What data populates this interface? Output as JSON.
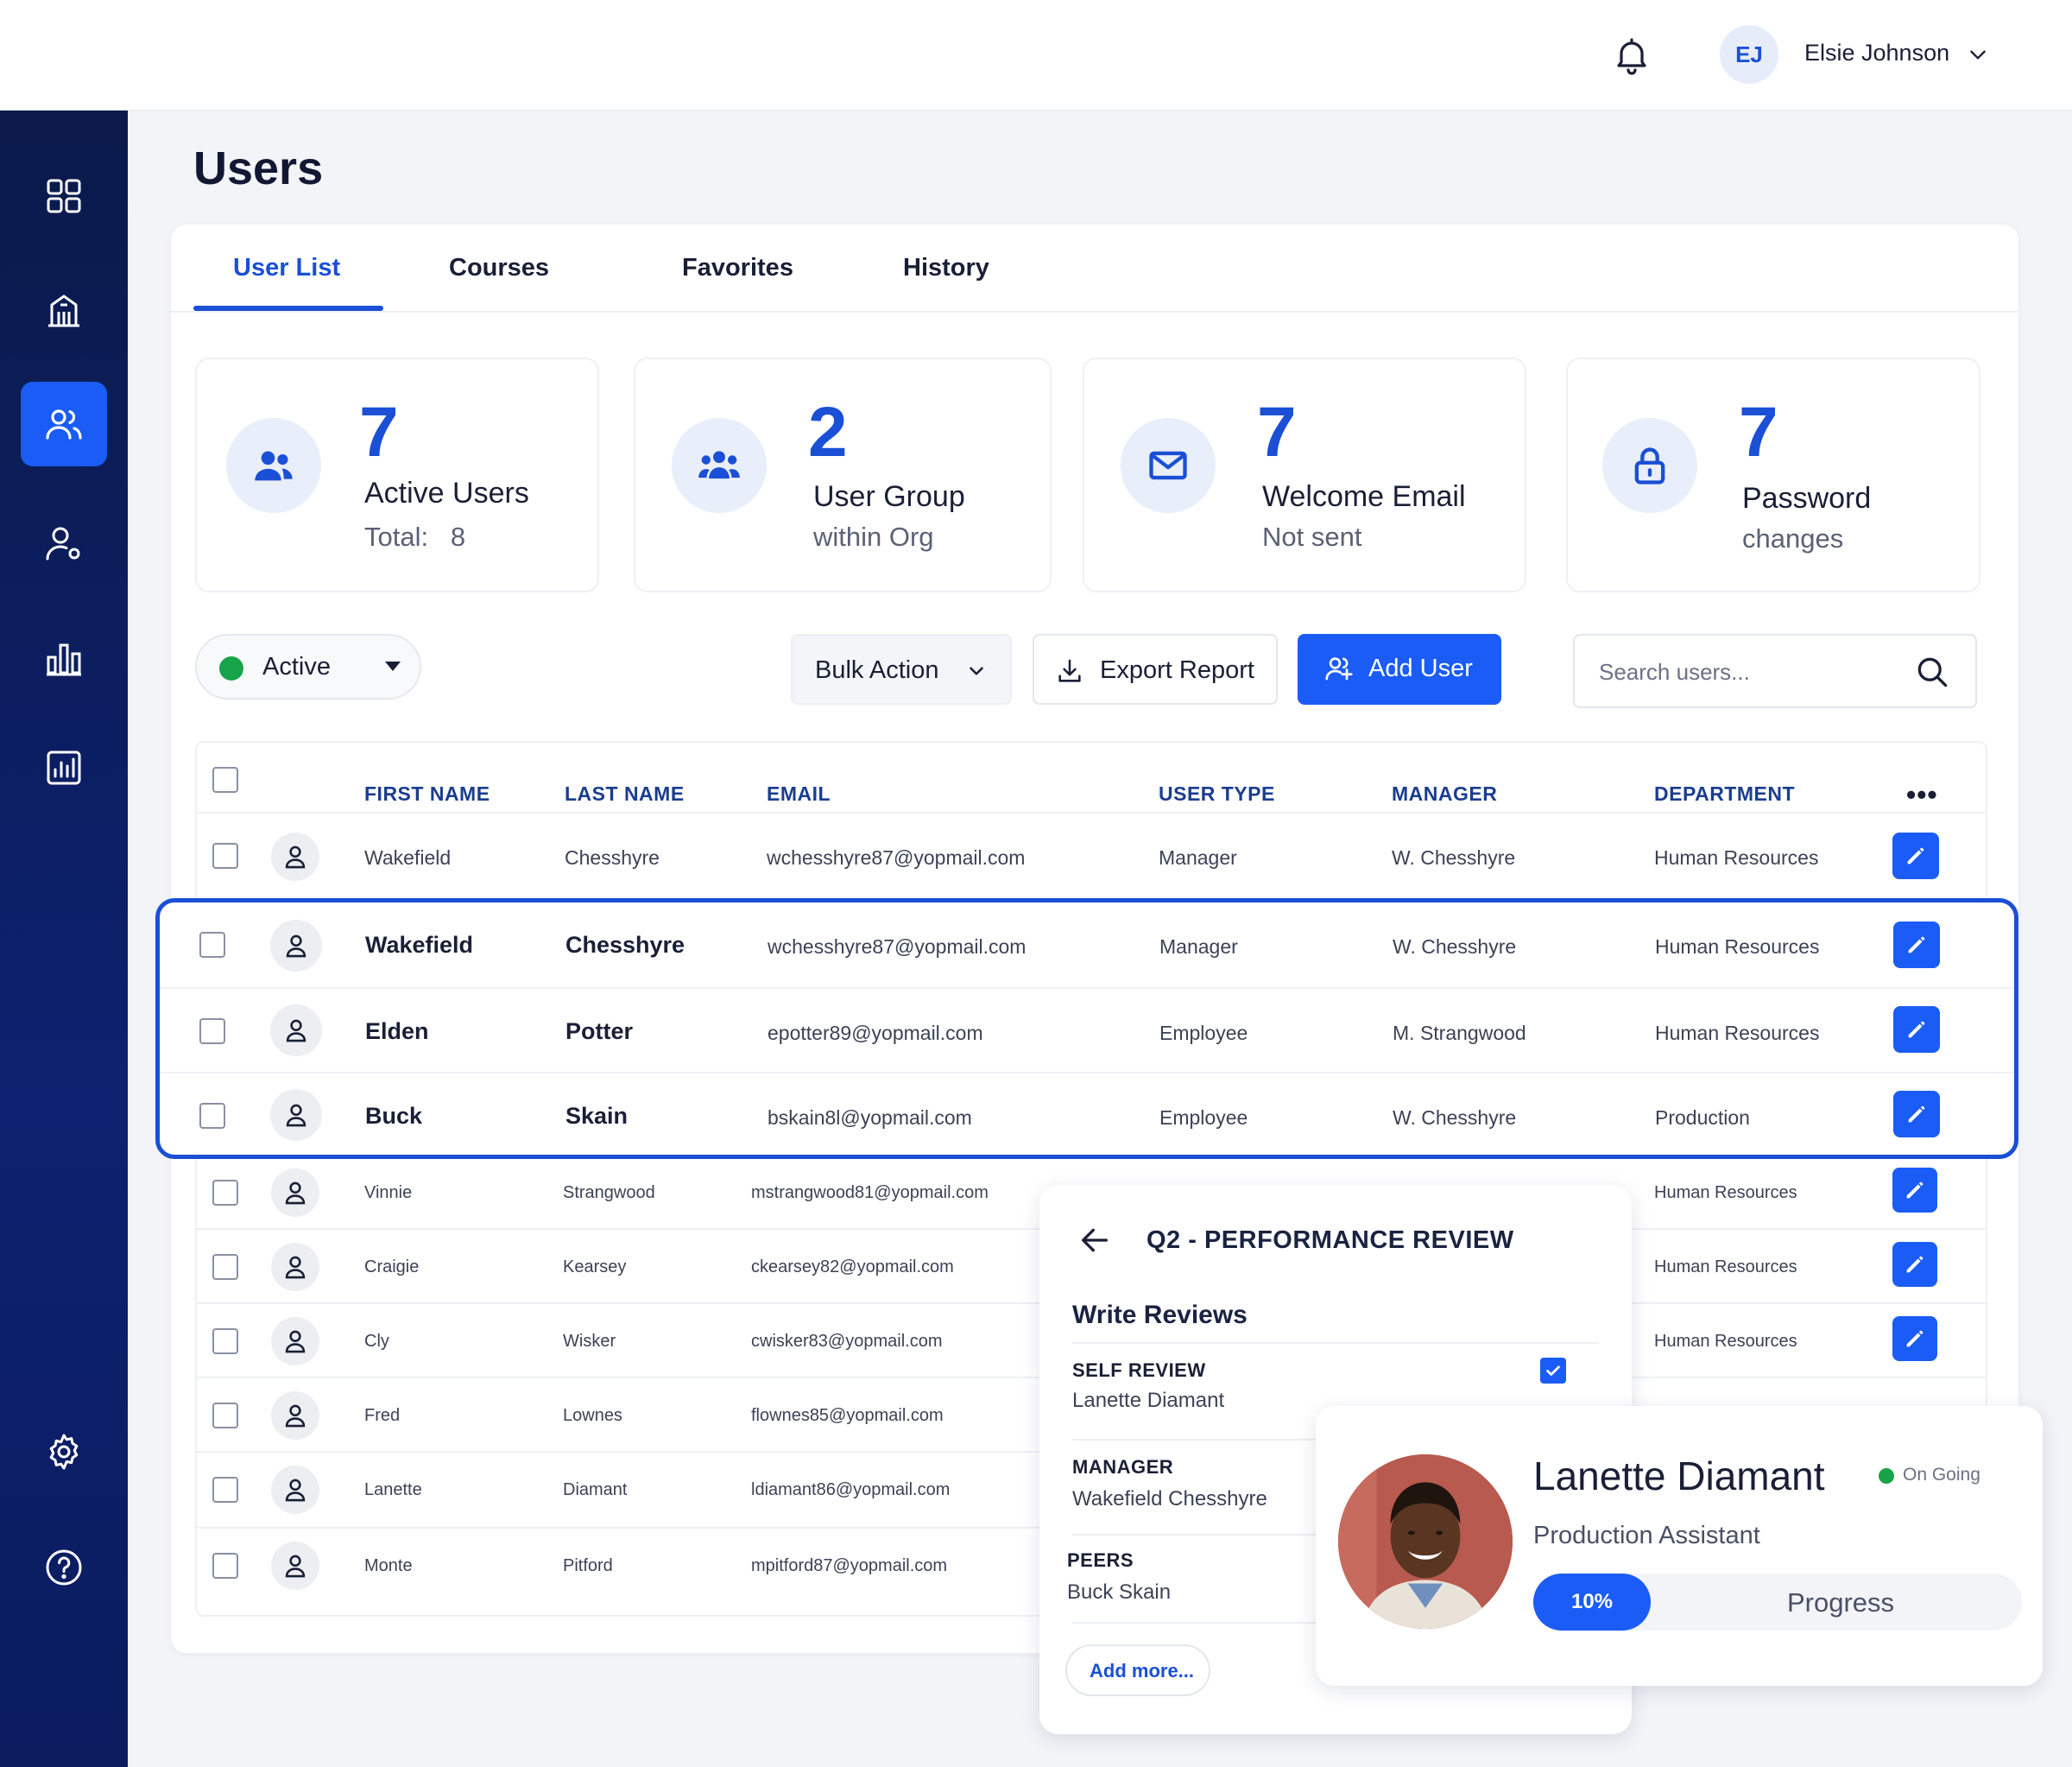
{
  "header": {
    "user_initials": "EJ",
    "user_name": "Elsie Johnson"
  },
  "sidebar": {
    "items": [
      {
        "icon": "dashboard-icon"
      },
      {
        "icon": "building-icon"
      },
      {
        "icon": "users-icon",
        "active": true
      },
      {
        "icon": "user-settings-icon"
      },
      {
        "icon": "bar-chart-icon"
      },
      {
        "icon": "report-icon"
      },
      {
        "icon": "gear-icon"
      },
      {
        "icon": "help-icon"
      }
    ]
  },
  "page": {
    "title": "Users"
  },
  "tabs": [
    {
      "label": "User List",
      "active": true
    },
    {
      "label": "Courses"
    },
    {
      "label": "Favorites"
    },
    {
      "label": "History"
    }
  ],
  "stats": [
    {
      "value": "7",
      "label": "Active Users",
      "sub": "Total:   8",
      "icon": "users-icon"
    },
    {
      "value": "2",
      "label": "User Group",
      "sub": "within Org",
      "icon": "group-icon"
    },
    {
      "value": "7",
      "label": "Welcome Email",
      "sub": "Not sent",
      "icon": "mail-icon"
    },
    {
      "value": "7",
      "label": "Password",
      "sub": "changes",
      "icon": "lock-icon"
    }
  ],
  "toolbar": {
    "status_label": "Active",
    "bulk_label": "Bulk Action",
    "export_label": "Export Report",
    "add_label": "Add User",
    "search_placeholder": "Search users..."
  },
  "table": {
    "columns": [
      "FIRST NAME",
      "LAST NAME",
      "EMAIL",
      "USER TYPE",
      "MANAGER",
      "DEPARTMENT"
    ],
    "rows": [
      {
        "first": "Wakefield",
        "last": "Chesshyre",
        "email": "wchesshyre87@yopmail.com",
        "type": "Manager",
        "manager": "W. Chesshyre",
        "dept": "Human Resources"
      },
      {
        "first": "Wakefield",
        "last": "Chesshyre",
        "email": "wchesshyre87@yopmail.com",
        "type": "Manager",
        "manager": "W. Chesshyre",
        "dept": "Human Resources"
      },
      {
        "first": "Elden",
        "last": "Potter",
        "email": "epotter89@yopmail.com",
        "type": "Employee",
        "manager": "M. Strangwood",
        "dept": "Human Resources"
      },
      {
        "first": "Buck",
        "last": "Skain",
        "email": "bskain8l@yopmail.com",
        "type": "Employee",
        "manager": "W. Chesshyre",
        "dept": "Production"
      },
      {
        "first": "Vinnie",
        "last": "Strangwood",
        "email": "mstrangwood81@yopmail.com",
        "dept": "Human Resources"
      },
      {
        "first": "Craigie",
        "last": "Kearsey",
        "email": "ckearsey82@yopmail.com",
        "dept": "Human Resources"
      },
      {
        "first": "Cly",
        "last": "Wisker",
        "email": "cwisker83@yopmail.com",
        "dept": "Human Resources"
      },
      {
        "first": "Fred",
        "last": "Lownes",
        "email": "flownes85@yopmail.com"
      },
      {
        "first": "Lanette",
        "last": "Diamant",
        "email": "ldiamant86@yopmail.com"
      },
      {
        "first": "Monte",
        "last": "Pitford",
        "email": "mpitford87@yopmail.com"
      }
    ]
  },
  "review": {
    "title": "Q2 - PERFORMANCE REVIEW",
    "section_title": "Write Reviews",
    "items": [
      {
        "heading": "SELF REVIEW",
        "name": "Lanette Diamant",
        "checked": true
      },
      {
        "heading": "MANAGER",
        "name": "Wakefield Chesshyre"
      },
      {
        "heading": "PEERS",
        "name": "Buck Skain"
      }
    ],
    "add_more_label": "Add more..."
  },
  "profile": {
    "name": "Lanette Diamant",
    "status": "On Going",
    "role": "Production Assistant",
    "progress_value": 10,
    "progress_text": "10%",
    "progress_label": "Progress"
  },
  "colors": {
    "accent": "#1a5cf5",
    "accent_text": "#1a4fd6",
    "sidebar": "#0d2170",
    "status_green": "#17a34a"
  }
}
